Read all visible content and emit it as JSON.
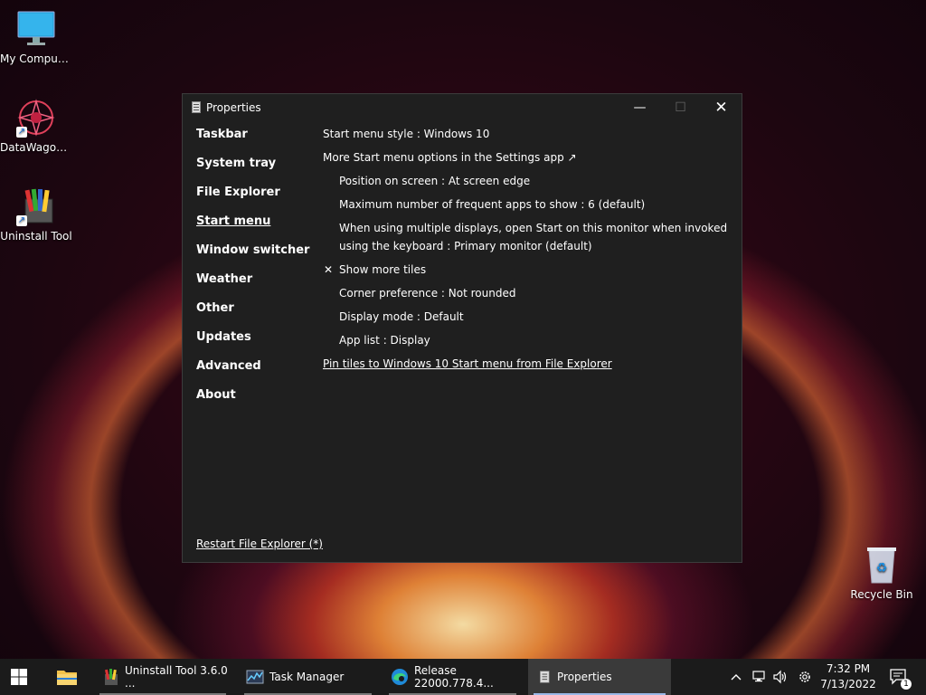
{
  "desktop": {
    "icons": [
      {
        "label": "My Computer"
      },
      {
        "label": "DataWagon..."
      },
      {
        "label": "Uninstall Tool"
      },
      {
        "label": "Recycle Bin"
      }
    ]
  },
  "window": {
    "title": "Properties",
    "controls": {
      "minimize": "—",
      "maximize": "☐",
      "close": "✕"
    },
    "nav": [
      {
        "label": "Taskbar"
      },
      {
        "label": "System tray"
      },
      {
        "label": "File Explorer"
      },
      {
        "label": "Start menu",
        "active": true
      },
      {
        "label": "Window switcher"
      },
      {
        "label": "Weather"
      },
      {
        "label": "Other"
      },
      {
        "label": "Updates"
      },
      {
        "label": "Advanced"
      },
      {
        "label": "About"
      }
    ],
    "settings": {
      "start_menu_style": "Start menu style : Windows 10",
      "more_options": "More Start menu options in the Settings app ↗",
      "position": "Position on screen : At screen edge",
      "max_frequent": "Maximum number of frequent apps to show : 6 (default)",
      "multi_display": "When using multiple displays, open Start on this monitor when invoked using the keyboard : Primary monitor (default)",
      "show_more_tiles": "Show more tiles",
      "show_more_tiles_check": "✕",
      "corner": "Corner preference : Not rounded",
      "display_mode": "Display mode : Default",
      "app_list": "App list : Display",
      "pin_tiles": "Pin tiles to Windows 10 Start menu from File Explorer"
    },
    "restart": "Restart File Explorer (*)"
  },
  "taskbar": {
    "items": [
      {
        "label": "Uninstall Tool 3.6.0 ..."
      },
      {
        "label": "Task Manager"
      },
      {
        "label": "Release 22000.778.4..."
      },
      {
        "label": "Properties"
      }
    ],
    "tray": {
      "chevron": "^",
      "notification_count": "1"
    },
    "clock": {
      "time": "7:32 PM",
      "date": "7/13/2022"
    }
  },
  "colors": {
    "window_bg": "#1f1f1f",
    "taskbar_bg": "#1b1b1b",
    "active_indicator": "#9ab8e8"
  }
}
